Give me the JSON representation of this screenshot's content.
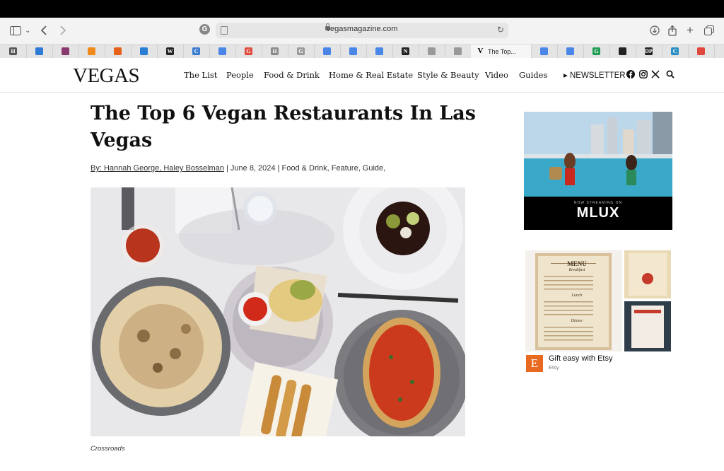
{
  "browser": {
    "url_host": "vegasmagazine.com",
    "tabs": [
      {
        "letter": "H",
        "color": "#555555"
      },
      {
        "letter": "",
        "color": "#2e7bd6"
      },
      {
        "letter": "",
        "color": "#8a3a6e"
      },
      {
        "letter": "",
        "color": "#f08a1c"
      },
      {
        "letter": "",
        "color": "#e8611a"
      },
      {
        "letter": "",
        "color": "#2a7fd4"
      },
      {
        "letter": "W",
        "color": "#222222"
      },
      {
        "letter": "C",
        "color": "#3b7bd0"
      },
      {
        "letter": "",
        "color": "#4a86e8"
      },
      {
        "letter": "G",
        "color": "#de4c3c"
      },
      {
        "letter": "H",
        "color": "#8a8a8a"
      },
      {
        "letter": "G",
        "color": "#9a9a9a"
      },
      {
        "letter": "",
        "color": "#4a86e8"
      },
      {
        "letter": "",
        "color": "#4a86e8"
      },
      {
        "letter": "",
        "color": "#4a86e8"
      },
      {
        "letter": "N",
        "color": "#222222"
      },
      {
        "letter": "",
        "color": "#999999"
      },
      {
        "letter": "",
        "color": "#999999"
      },
      {
        "letter": "V",
        "color": "#000000",
        "label": "The Top...",
        "active": true
      },
      {
        "letter": "",
        "color": "#4a86e8"
      },
      {
        "letter": "",
        "color": "#4a86e8"
      },
      {
        "letter": "G",
        "color": "#1f9d55"
      },
      {
        "letter": "",
        "color": "#222222"
      },
      {
        "letter": "DP",
        "color": "#222222"
      },
      {
        "letter": "C",
        "color": "#2a8fc4"
      },
      {
        "letter": "",
        "color": "#e0463b"
      }
    ]
  },
  "site": {
    "logo": "VEGAS",
    "nav": [
      "The List",
      "People",
      "Food & Drink",
      "Home & Real Estate",
      "Style & Beauty",
      "Video",
      "Guides"
    ],
    "newsletter": "▸ NEWSLETTER"
  },
  "article": {
    "title": "The Top 6 Vegan Restaurants In Las Vegas",
    "byline_authors": "By: Hannah George, Haley Bosselman",
    "byline_rest": " | June 8, 2024 | Food & Drink, Feature, Guide,",
    "caption": "Crossroads"
  },
  "ads": {
    "mlux_stream": "NOW STREAMING ON",
    "mlux_brand": "MLUX",
    "menu_title": "MENU",
    "menu_sections": [
      "Breakfast",
      "Lunch",
      "Dinner"
    ],
    "etsy_logo": "E",
    "etsy_headline": "Gift easy with Etsy",
    "etsy_sub": "Etsy"
  },
  "colors": {
    "accent_etsy": "#e86a20",
    "ad_choice_blue": "#3a7bd5"
  },
  "icons": [
    "sidebar-toggle-icon",
    "chevron-down-icon",
    "back-icon",
    "forward-icon",
    "download-icon",
    "share-icon",
    "new-tab-icon",
    "tab-overview-icon",
    "facebook-icon",
    "instagram-icon",
    "x-icon",
    "search-icon"
  ]
}
